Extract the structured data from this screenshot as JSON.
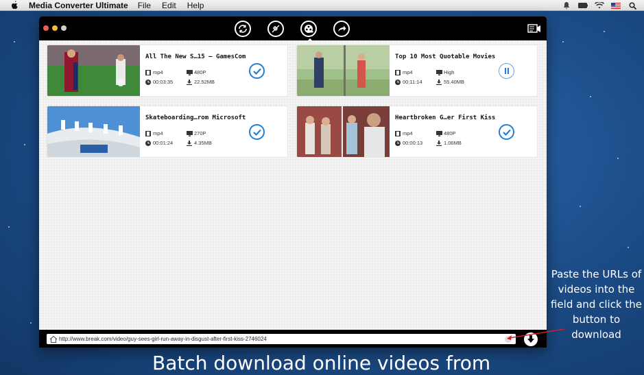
{
  "menubar": {
    "app_name": "Media Converter Ultimate",
    "menus": [
      "File",
      "Edit",
      "Help"
    ]
  },
  "toolbar": {
    "buttons": [
      "convert-icon",
      "dvd-icon",
      "download-icon",
      "share-icon"
    ],
    "active": "download-icon"
  },
  "videos": [
    {
      "title": "All The New S…15 – GamesCom",
      "format": "mp4",
      "quality": "480P",
      "duration": "00:03:35",
      "size": "22.52MB",
      "status": "done"
    },
    {
      "title": "Top 10 Most Quotable Movies",
      "format": "mp4",
      "quality": "High",
      "duration": "00:11:14",
      "size": "55.40MB",
      "status": "paused"
    },
    {
      "title": "Skateboarding…rom Microsoft",
      "format": "mp4",
      "quality": "270P",
      "duration": "00:01:24",
      "size": "4.35MB",
      "status": "done"
    },
    {
      "title": "Heartbroken G…er First Kiss",
      "format": "mp4",
      "quality": "480P",
      "duration": "00:00:13",
      "size": "1.06MB",
      "status": "done"
    }
  ],
  "url_bar": {
    "value": "http://www.break.com/video/guy-sees-girl-run-away-in-disgust-after-first-kiss-2746024"
  },
  "annotation": "Paste the URLs of videos into the field and click the button to download",
  "caption": "Batch download online videos from",
  "colors": {
    "accent": "#1f7fd6",
    "toolbar": "#000000",
    "desktop": "#1d4f8c"
  }
}
